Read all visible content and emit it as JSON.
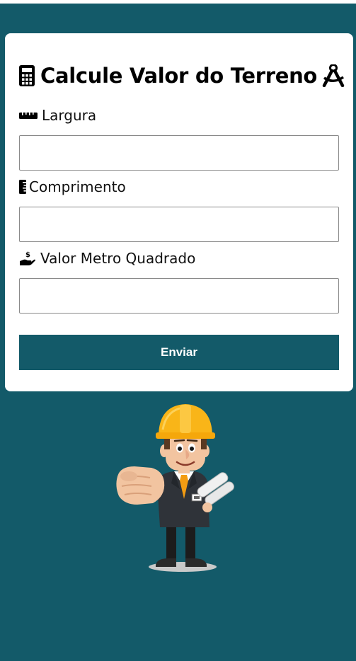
{
  "form": {
    "title": "Calcule Valor do Terreno",
    "title_icon_left": "calculator-icon",
    "title_icon_right": "drafting-compass-icon",
    "fields": [
      {
        "label": "Largura",
        "icon": "ruler-horizontal-icon",
        "value": "",
        "placeholder": ""
      },
      {
        "label": "Comprimento",
        "icon": "ruler-vertical-icon",
        "value": "",
        "placeholder": ""
      },
      {
        "label": "Valor Metro Quadrado",
        "icon": "hand-holding-usd-icon",
        "value": "",
        "placeholder": ""
      }
    ],
    "submit_label": "Enviar"
  },
  "illustration": {
    "name": "engineer-mascot"
  },
  "colors": {
    "background": "#135a69",
    "button": "#135a69",
    "card": "#ffffff",
    "helmet": "#f9b518"
  }
}
